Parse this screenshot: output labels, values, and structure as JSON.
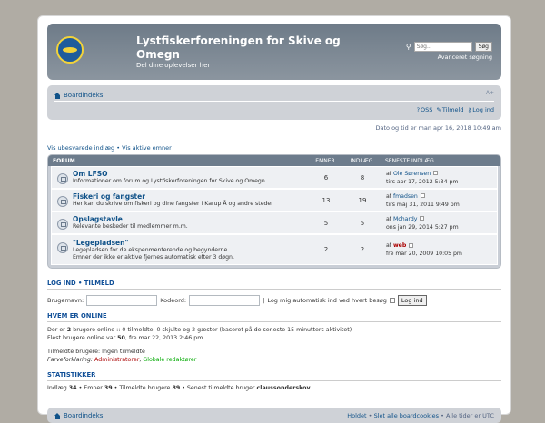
{
  "header": {
    "title": "Lystfiskerforeningen for Skive og Omegn",
    "description": "Del dine oplevelser her",
    "search_placeholder": "Søg...",
    "search_button": "Søg",
    "advanced_search": "Avanceret søgning"
  },
  "nav": {
    "home": "Boardindeks",
    "resize": "-A+",
    "faq": "OSS",
    "register": "Tilmeld",
    "login": "Log ind"
  },
  "date_line": "Dato og tid er man apr 16, 2018 10:49 am",
  "view_links": {
    "unanswered": "Vis ubesvarede indlæg",
    "separator": "•",
    "active": "Vis aktive emner"
  },
  "forum_table": {
    "headers": {
      "forum": "FORUM",
      "topics": "EMNER",
      "posts": "INDLÆG",
      "last": "SENESTE INDLÆG"
    },
    "rows": [
      {
        "name": "Om LFSO",
        "desc": "Informationer om forum og Lystfiskerforeningen for Skive og Omegn",
        "desc2": "",
        "topics": "6",
        "posts": "8",
        "by": "af",
        "user": "Ole Sørensen",
        "date": "tirs apr 17, 2012 5:34 pm"
      },
      {
        "name": "Fiskeri og fangster",
        "desc": "Her kan du skrive om fiskeri og dine fangster i Karup Å og andre steder",
        "desc2": "",
        "topics": "13",
        "posts": "19",
        "by": "af",
        "user": "fmadsen",
        "date": "tirs maj 31, 2011 9:49 pm"
      },
      {
        "name": "Opslagstavle",
        "desc": "Relevante beskeder til medlemmer m.m.",
        "desc2": "",
        "topics": "5",
        "posts": "5",
        "by": "af",
        "user": "Mchardy",
        "date": "ons jan 29, 2014 5:27 pm"
      },
      {
        "name": "\"Legepladsen\"",
        "desc": "Legepladsen for de ekspenmenterende og begynderne.",
        "desc2": "Emner der ikke er aktive fjernes automatisk efter 3 døgn.",
        "topics": "2",
        "posts": "2",
        "by": "af",
        "user": "web",
        "date": "fre mar 20, 2009 10:05 pm"
      }
    ]
  },
  "login": {
    "title_login": "LOG IND",
    "title_sep": "•",
    "title_register": "TILMELD",
    "username_label": "Brugernavn:",
    "password_label": "Kodeord:",
    "separator": "|",
    "auto_label": "Log mig automatisk ind ved hvert besøg",
    "button": "Log ind"
  },
  "who": {
    "title": "HVEM ER ONLINE",
    "line1_a": "Der er",
    "line1_count": "2",
    "line1_b": "brugere online :: 0 tilmeldte, 0 skjulte og 2 gæster (baseret på de seneste 15 minutters aktivitet)",
    "line2_a": "Flest brugere online var",
    "line2_count": "50",
    "line2_b": ", fre mar 22, 2013 2:46 pm",
    "registered": "Tilmeldte brugere: Ingen tilmeldte",
    "legend_label": "Farveforklaring:",
    "legend_admin": "Administratorer",
    "legend_sep": ",",
    "legend_mod": "Globale redaktører"
  },
  "stats": {
    "title": "STATISTIKKER",
    "posts_label": "Indlæg",
    "posts": "34",
    "topics_label": "• Emner",
    "topics": "39",
    "members_label": "• Tilmeldte brugere",
    "members": "89",
    "newest_label": "• Senest tilmeldte bruger",
    "newest": "claussonderskov"
  },
  "footer": {
    "home": "Boardindeks",
    "team": "Holdet",
    "sep1": "•",
    "delete_cookies": "Slet alle boardcookies",
    "sep2": "•",
    "timezone": "Alle tider er UTC"
  }
}
